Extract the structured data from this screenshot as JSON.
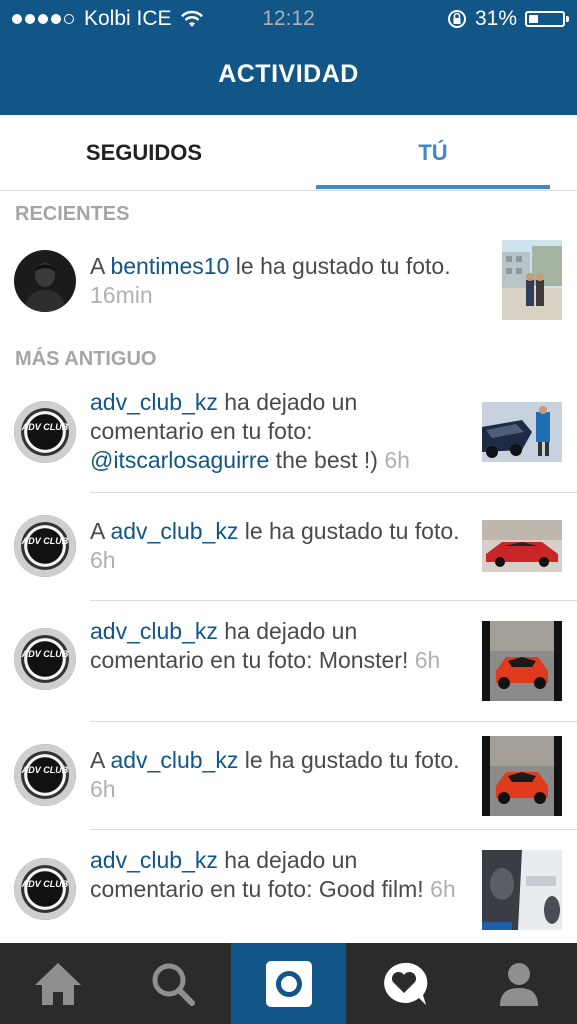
{
  "status": {
    "carrier": "Kolbi ICE",
    "time": "12:12",
    "battery": "31%",
    "battery_level": 0.31,
    "signal_bars": 4
  },
  "header": {
    "title": "ACTIVIDAD"
  },
  "tabs": [
    {
      "label": "SEGUIDOS"
    },
    {
      "label": "TÚ"
    }
  ],
  "sections": {
    "recent": "RECIENTES",
    "older": "MÁS ANTIGUO"
  },
  "recent": [
    {
      "prefix": "A ",
      "user": "bentimes10",
      "text": " le ha gustado tu foto. ",
      "time": "16min"
    }
  ],
  "older": [
    {
      "prefix": "",
      "user": "adv_club_kz",
      "text": " ha dejado un comentario en tu foto: ",
      "mention": "@itscarlosaguirre",
      "comment": " the best !) ",
      "time": "6h"
    },
    {
      "prefix": "A ",
      "user": "adv_club_kz",
      "text": " le ha gustado tu foto. ",
      "time": "6h"
    },
    {
      "prefix": "",
      "user": "adv_club_kz",
      "text": " ha dejado un comentario en tu foto: Monster! ",
      "time": "6h"
    },
    {
      "prefix": "A ",
      "user": "adv_club_kz",
      "text": " le ha gustado tu foto. ",
      "time": "6h"
    },
    {
      "prefix": "",
      "user": "adv_club_kz",
      "text": " ha dejado un comentario en tu foto: Good film! ",
      "time": "6h"
    }
  ],
  "avatar_badge": "ADV CLUB",
  "nav": [
    "home-icon",
    "search-icon",
    "camera-icon",
    "activity-heart-icon",
    "profile-icon"
  ],
  "colors": {
    "brand": "#125688",
    "accent": "#3f89c9",
    "nav_bg": "#2b2b2b"
  }
}
